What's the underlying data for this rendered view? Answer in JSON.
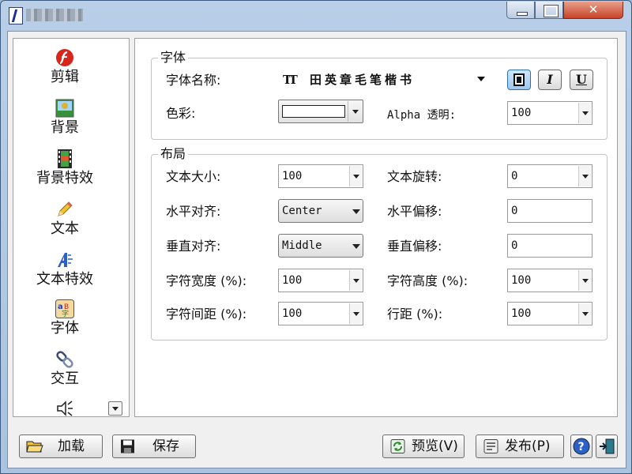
{
  "window": {
    "title_blurred": true
  },
  "sidebar": {
    "items": [
      {
        "label": "剪辑",
        "icon": "flash-icon"
      },
      {
        "label": "背景",
        "icon": "landscape-image-icon"
      },
      {
        "label": "背景特效",
        "icon": "film-strip-icon"
      },
      {
        "label": "文本",
        "icon": "pencil-icon"
      },
      {
        "label": "文本特效",
        "icon": "text-effect-a-icon"
      },
      {
        "label": "字体",
        "icon": "font-ab-icon"
      },
      {
        "label": "交互",
        "icon": "link-chain-icon"
      },
      {
        "label": "",
        "icon": "speaker-icon"
      }
    ]
  },
  "font_group": {
    "title": "字体",
    "font_name_label": "字体名称:",
    "font_name_value": "田英章毛笔楷书",
    "color_label": "色彩:",
    "color_value": "#ffffff",
    "alpha_label": "Alpha 透明:",
    "alpha_value": "100",
    "bold": "B",
    "italic": "I",
    "underline": "U"
  },
  "layout_group": {
    "title": "布局",
    "text_size_label": "文本大小:",
    "text_size_value": "100",
    "text_rotate_label": "文本旋转:",
    "text_rotate_value": "0",
    "h_align_label": "水平对齐:",
    "h_align_value": "Center",
    "h_offset_label": "水平偏移:",
    "h_offset_value": "0",
    "v_align_label": "垂直对齐:",
    "v_align_value": "Middle",
    "v_offset_label": "垂直偏移:",
    "v_offset_value": "0",
    "char_width_label": "字符宽度 (%):",
    "char_width_value": "100",
    "char_height_label": "字符高度 (%):",
    "char_height_value": "100",
    "char_spacing_label": "字符间距 (%):",
    "char_spacing_value": "100",
    "line_spacing_label": "行距 (%):",
    "line_spacing_value": "100"
  },
  "buttons": {
    "load": "加载",
    "save": "保存",
    "preview": "预览(V)",
    "publish": "发布(P)"
  },
  "colors": {
    "accent": "#2e6fb0",
    "flash_red": "#d8261c"
  }
}
